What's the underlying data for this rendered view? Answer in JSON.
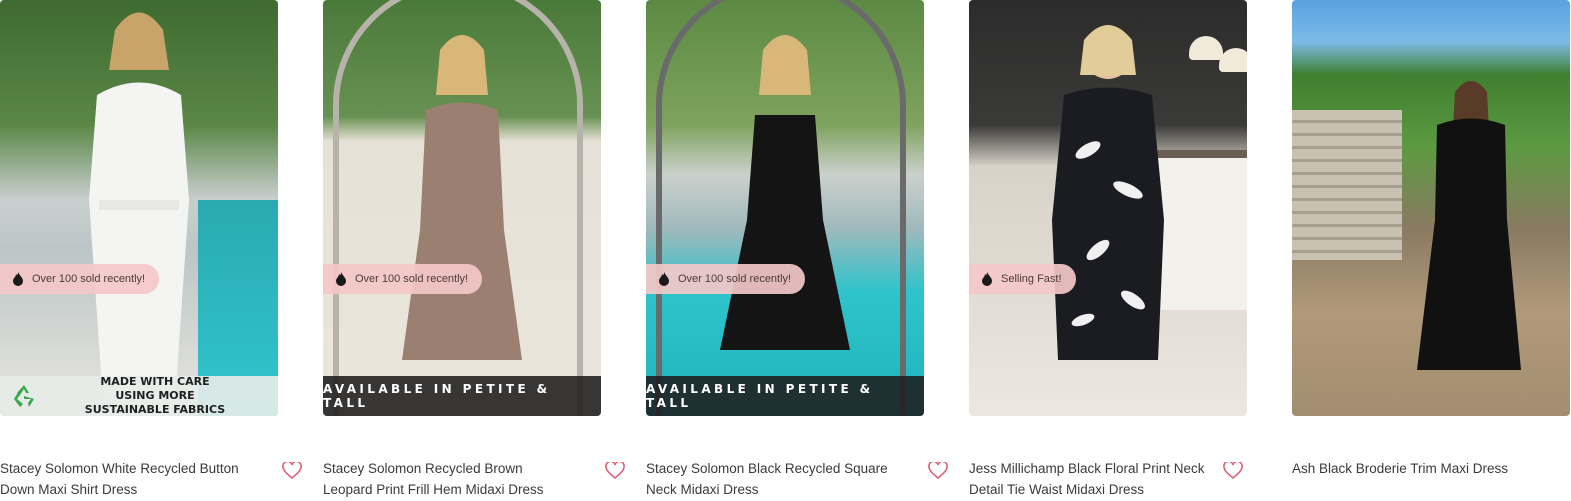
{
  "products": [
    {
      "name": "Stacey Solomon White Recycled Button Down Maxi Shirt Dress",
      "badge": "Over 100 sold recently!",
      "overlay": "MADE WITH CARE USING MORE SUSTAINABLE FABRICS",
      "overlay_type": "sustainable",
      "dress_color": "#f4f4f2"
    },
    {
      "name": "Stacey Solomon Recycled Brown Leopard Print Frill Hem Midaxi Dress",
      "badge": "Over 100 sold recently!",
      "overlay": "AVAILABLE IN PETITE & TALL",
      "overlay_type": "banner",
      "dress_color": "#9b7f70"
    },
    {
      "name": "Stacey Solomon Black Recycled Square Neck Midaxi Dress",
      "badge": "Over 100 sold recently!",
      "overlay": "AVAILABLE IN PETITE & TALL",
      "overlay_type": "banner",
      "dress_color": "#141414"
    },
    {
      "name": "Jess Millichamp Black Floral Print Neck Detail Tie Waist Midaxi Dress",
      "badge": "Selling Fast!",
      "overlay": "",
      "overlay_type": "none",
      "dress_color": "#1b1b22"
    },
    {
      "name": "Ash Black Broderie Trim Maxi Dress",
      "badge": "",
      "overlay": "",
      "overlay_type": "none",
      "dress_color": "#111111"
    }
  ],
  "colors": {
    "badge_bg": "#f4c8c8",
    "heart": "#e0607a",
    "banner_bg": "#1e1e1e",
    "recycle_green": "#39a84a"
  },
  "icons": {
    "badge": "flame-icon",
    "wishlist": "heart-icon",
    "sustainable": "recycle-icon"
  }
}
